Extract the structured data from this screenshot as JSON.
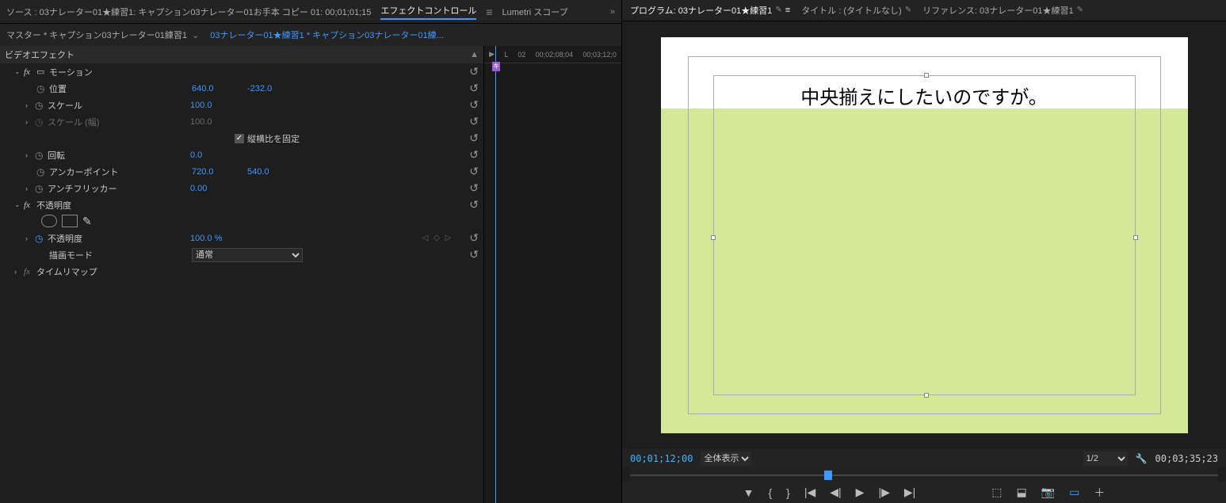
{
  "leftTabs": {
    "source": "ソース : 03ナレーター01★練習1: キャプション03ナレーター01お手本 コピー 01: 00;01;01;15",
    "effectControls": "エフェクトコントロール",
    "lumetri": "Lumetri スコープ",
    "arrow": "»"
  },
  "breadcrumb": {
    "master": "マスター * キャプション03ナレーター01練習1",
    "sequence": "03ナレーター01★練習1 * キャプション03ナレーター01練..."
  },
  "timelineRuler": [
    "L",
    "02",
    "00;02;08;04",
    "00;03;12;0"
  ],
  "sections": {
    "videoEffects": "ビデオエフェクト",
    "motion": "モーション",
    "opacity": "不透明度",
    "timeRemap": "タイムリマップ"
  },
  "props": {
    "position": {
      "label": "位置",
      "x": "640.0",
      "y": "-232.0"
    },
    "scale": {
      "label": "スケール",
      "value": "100.0"
    },
    "scaleWidth": {
      "label": "スケール (幅)",
      "value": "100.0"
    },
    "uniform": {
      "label": "縦横比を固定"
    },
    "rotation": {
      "label": "回転",
      "value": "0.0"
    },
    "anchor": {
      "label": "アンカーポイント",
      "x": "720.0",
      "y": "540.0"
    },
    "antiFlicker": {
      "label": "アンチフリッカー",
      "value": "0.00"
    },
    "opacity": {
      "label": "不透明度",
      "value": "100.0 %"
    },
    "blendMode": {
      "label": "描画モード",
      "value": "通常"
    }
  },
  "playheadMarker": "キ",
  "rightTabs": {
    "program": "プログラム: 03ナレーター01★練習1",
    "title": "タイトル : (タイトルなし)",
    "reference": "リファレンス: 03ナレーター01★練習1"
  },
  "canvasText": "中央揃えにしたいのですが。",
  "playback": {
    "currentTC": "00;01;12;00",
    "zoom": "全体表示",
    "res": "1/2",
    "durationTC": "00;03;35;23"
  }
}
